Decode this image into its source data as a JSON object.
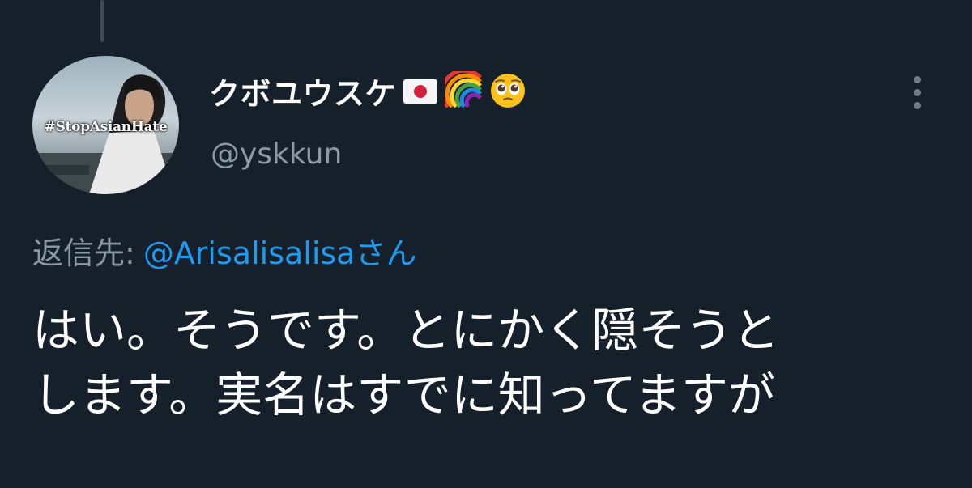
{
  "tweet": {
    "display_name": "クボユウスケ",
    "name_emojis": [
      "japan-flag",
      "rainbow",
      "pleading-face"
    ],
    "handle": "@yskkun",
    "avatar_badge_text": "#StopAsianHate",
    "reply_prefix": "返信先:",
    "reply_mention": "@Arisalisalisaさん",
    "body_line1": "はい。そうです。とにかく隠そうと",
    "body_line2": "します。実名はすでに知ってますが"
  },
  "colors": {
    "background": "#16202b",
    "text_primary": "#ffffff",
    "text_secondary": "#8b98a5",
    "link": "#1d9bf0"
  }
}
